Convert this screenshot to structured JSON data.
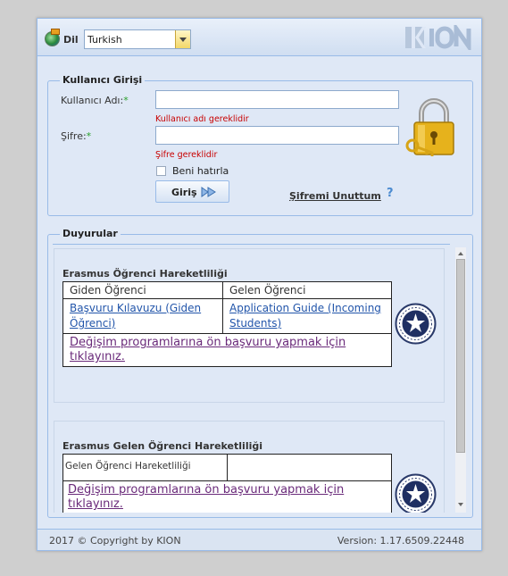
{
  "header": {
    "language_label": "Dil",
    "language_value": "Turkish",
    "logo_text": "KION"
  },
  "login": {
    "legend": "Kullanıcı Girişi",
    "username_label": "Kullanıcı Adı:",
    "username_required": "*",
    "username_value": "",
    "username_error": "Kullanıcı adı gereklidir",
    "password_label": "Şifre:",
    "password_required": "*",
    "password_value": "",
    "password_error": "Şifre gereklidir",
    "remember_label": "Beni hatırla",
    "remember_checked": false,
    "login_button": "Giriş",
    "forgot_link": "Şifremi Unuttum",
    "help_icon": "?"
  },
  "announcements": {
    "legend": "Duyurular",
    "items": [
      {
        "title": "Erasmus Öğrenci Hareketliliği",
        "col1_header": "Giden Öğrenci",
        "col2_header": "Gelen Öğrenci",
        "col1_link": "Başvuru Kılavuzu (Giden Öğrenci)",
        "col2_link": "Application Guide (Incoming Students)",
        "footer_link": "Değişim programlarına ön başvuru yapmak için tıklayınız."
      },
      {
        "title": "Erasmus Gelen Öğrenci Hareketliliği",
        "col1_header": "Gelen Öğrenci Hareketliliği",
        "col2_header": "",
        "footer_link": "Değişim programlarına ön başvuru yapmak için tıklayınız."
      }
    ]
  },
  "footer": {
    "copyright": "2017 © Copyright by KION",
    "version": "Version: 1.17.6509.22448"
  },
  "colors": {
    "panel_bg": "#dfe8f6",
    "border": "#99bbe8",
    "error": "#c80000",
    "required": "#2aa02a",
    "link": "#2255aa",
    "visited_link": "#6a2a7a"
  }
}
